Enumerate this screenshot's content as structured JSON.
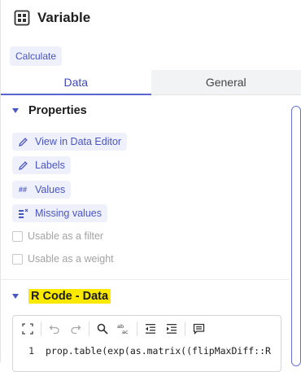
{
  "header": {
    "title": "Variable",
    "icon": "grid-icon"
  },
  "calculate_button": "Calculate",
  "tabs": [
    {
      "label": "Data",
      "active": true
    },
    {
      "label": "General",
      "active": false
    }
  ],
  "properties": {
    "title": "Properties",
    "actions": [
      {
        "label": "View in Data Editor",
        "icon": "pencil-icon"
      },
      {
        "label": "Labels",
        "icon": "pencil-icon"
      },
      {
        "label": "Values",
        "icon": "hash-icon",
        "icon_text": "##"
      },
      {
        "label": "Missing values",
        "icon": "missing-values-icon"
      }
    ],
    "checkboxes": [
      {
        "label": "Usable as a filter",
        "checked": false,
        "disabled": true
      },
      {
        "label": "Usable as a weight",
        "checked": false,
        "disabled": true
      }
    ]
  },
  "r_code": {
    "title": "R Code - Data",
    "highlight_color": "#fbe900",
    "toolbar": [
      "expand-icon",
      "undo-icon",
      "redo-icon",
      "search-icon",
      "replace-icon",
      "outdent-icon",
      "indent-icon",
      "comment-icon"
    ],
    "lines": [
      {
        "number": "1",
        "code": "prop.table(exp(as.matrix((flipMaxDiff::R"
      }
    ]
  },
  "colors": {
    "accent": "#4a55c4",
    "chip_bg": "#eef0fb",
    "tab_inactive_bg": "#f2f3f5"
  }
}
